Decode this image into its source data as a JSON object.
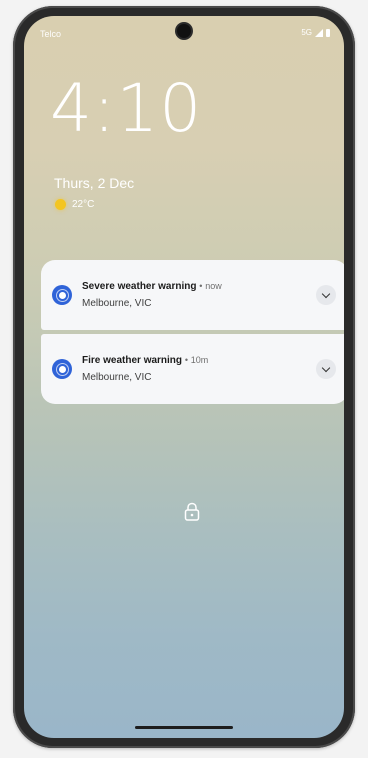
{
  "status_bar": {
    "carrier": "Telco",
    "network": "5G"
  },
  "lock_screen": {
    "time": "4:10",
    "date": "Thurs, 2 Dec",
    "weather": {
      "temperature": "22°C",
      "icon": "sun-icon"
    }
  },
  "notifications": [
    {
      "title": "Severe weather warning",
      "separator": "•",
      "time": "now",
      "location": "Melbourne, VIC",
      "icon": "alert-circle-icon"
    },
    {
      "title": "Fire weather warning",
      "separator": "•",
      "time": "10m",
      "location": "Melbourne, VIC",
      "icon": "alert-circle-icon"
    }
  ],
  "colors": {
    "notification_icon": "#2f63d8",
    "sun": "#f3c521"
  }
}
